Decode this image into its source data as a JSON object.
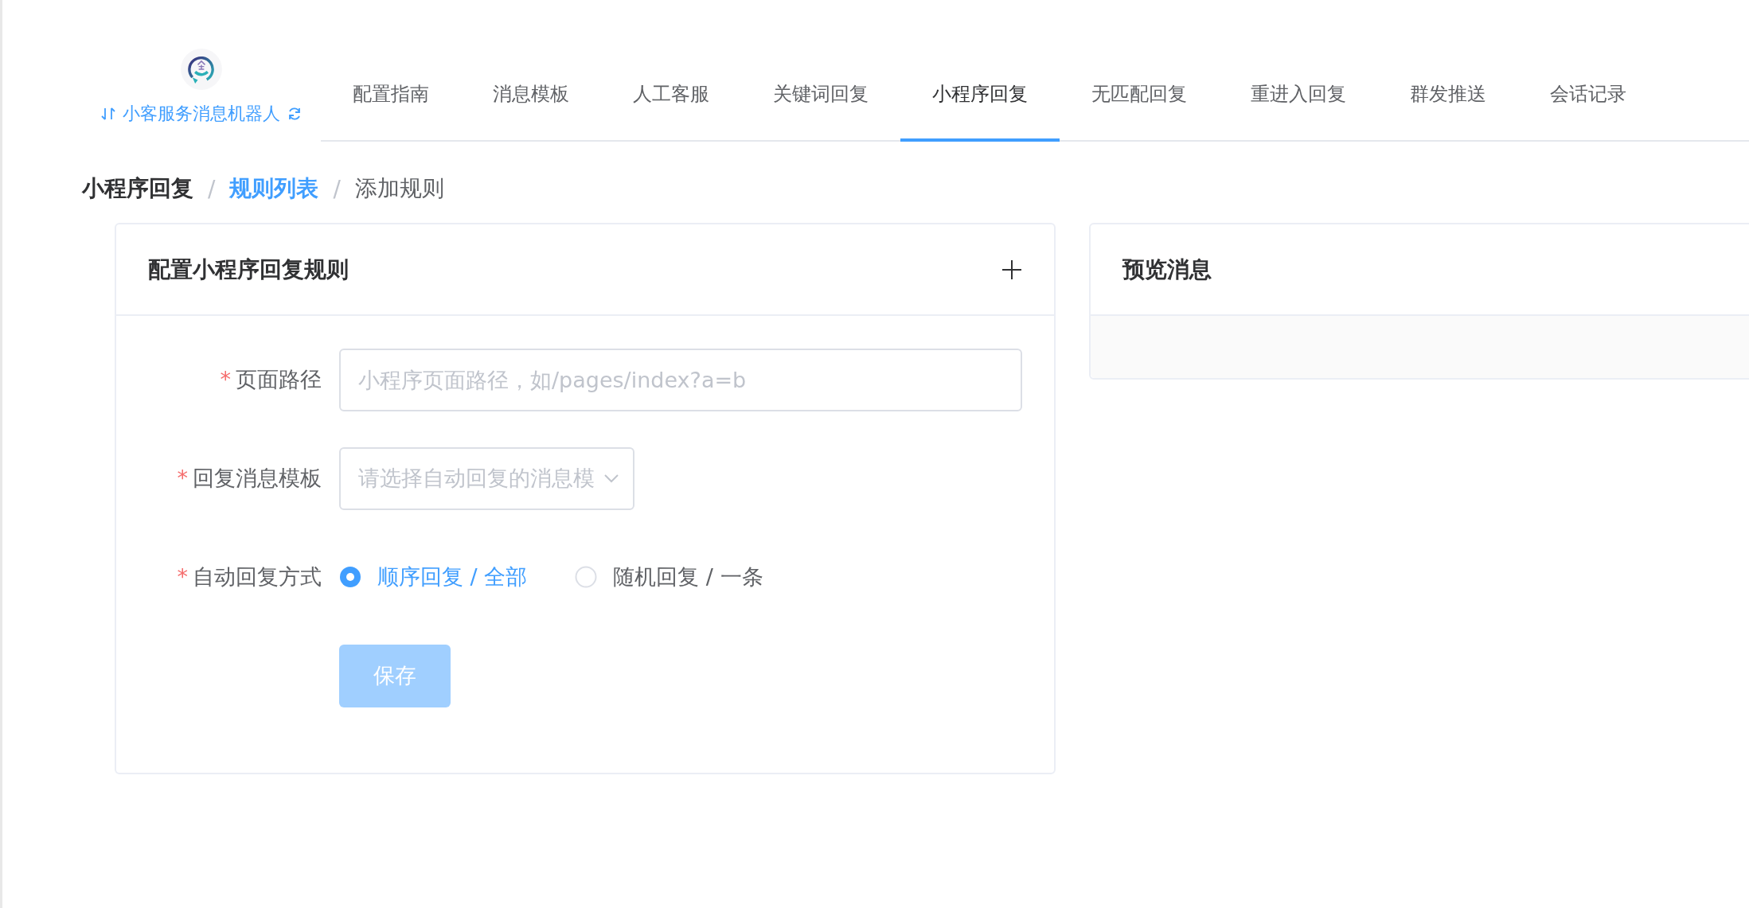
{
  "app": {
    "name": "小客服务消息机器人"
  },
  "tabs": [
    {
      "label": "配置指南",
      "selected": false
    },
    {
      "label": "消息模板",
      "selected": false
    },
    {
      "label": "人工客服",
      "selected": false
    },
    {
      "label": "关键词回复",
      "selected": false
    },
    {
      "label": "小程序回复",
      "selected": true
    },
    {
      "label": "无匹配回复",
      "selected": false
    },
    {
      "label": "重进入回复",
      "selected": false
    },
    {
      "label": "群发推送",
      "selected": false
    },
    {
      "label": "会话记录",
      "selected": false
    }
  ],
  "breadcrumb": [
    {
      "label": "小程序回复",
      "kind": "root",
      "separator": "/"
    },
    {
      "label": "规则列表",
      "kind": "link",
      "separator": "/"
    },
    {
      "label": "添加规则",
      "kind": "current"
    }
  ],
  "form_card": {
    "title": "配置小程序回复规则",
    "fields": [
      {
        "kind": "input",
        "label": "页面路径",
        "required_mark": "*",
        "placeholder": "小程序页面路径，如/pages/index?a=b"
      },
      {
        "kind": "select",
        "label": "回复消息模板",
        "required_mark": "*",
        "placeholder": "请选择自动回复的消息模"
      },
      {
        "kind": "radio",
        "label": "自动回复方式",
        "required_mark": "*",
        "options": [
          {
            "label": "顺序回复 / 全部",
            "selected": true
          },
          {
            "label": "随机回复 / 一条",
            "selected": false
          }
        ]
      }
    ],
    "save_button": {
      "label": "保存",
      "disabled": true
    }
  },
  "preview_card": {
    "title": "预览消息"
  }
}
